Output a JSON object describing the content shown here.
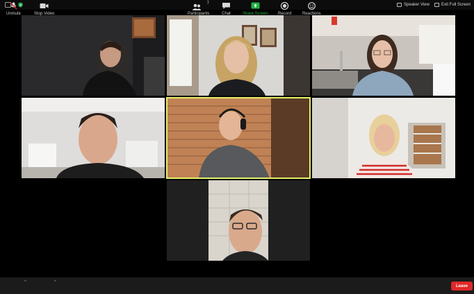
{
  "window": {
    "speaker_view_label": "Speaker View",
    "exit_full_screen_label": "Exit Full Screen",
    "info_icon": "info-icon",
    "security_icon": "shield-icon"
  },
  "participants_grid": {
    "active_speaker_index": 4,
    "active_color": "#e3f16a",
    "tile_count": 7
  },
  "controls": {
    "unmute": {
      "label": "Unmute",
      "icon": "microphone-muted-icon"
    },
    "stop_video": {
      "label": "Stop Video",
      "icon": "video-camera-icon"
    },
    "participants": {
      "label": "Participants",
      "icon": "participants-icon",
      "count": "7"
    },
    "chat": {
      "label": "Chat",
      "icon": "chat-icon"
    },
    "share_screen": {
      "label": "Share Screen",
      "icon": "share-screen-icon",
      "color": "#1fb141"
    },
    "record": {
      "label": "Record",
      "icon": "record-icon"
    },
    "reactions": {
      "label": "Reactions",
      "icon": "reactions-icon"
    },
    "leave": {
      "label": "Leave",
      "color": "#e02828"
    }
  }
}
